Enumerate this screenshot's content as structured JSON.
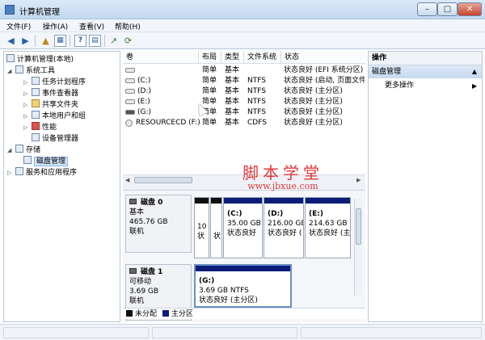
{
  "window": {
    "title": "计算机管理"
  },
  "menu": [
    "文件(F)",
    "操作(A)",
    "查看(V)",
    "帮助(H)"
  ],
  "toolbar": {
    "icons": [
      "back-arrow-icon",
      "forward-arrow-icon",
      "folder-up-icon",
      "console-tree-icon",
      "help-icon",
      "properties-icon",
      "export-icon",
      "refresh-icon"
    ]
  },
  "tree": {
    "items": [
      {
        "label": "计算机管理(本地)"
      },
      {
        "label": "系统工具"
      },
      {
        "label": "任务计划程序"
      },
      {
        "label": "事件查看器"
      },
      {
        "label": "共享文件夹"
      },
      {
        "label": "本地用户和组"
      },
      {
        "label": "性能"
      },
      {
        "label": "设备管理器"
      },
      {
        "label": "存储"
      },
      {
        "label": "磁盘管理"
      },
      {
        "label": "服务和应用程序"
      }
    ]
  },
  "volumes": {
    "columns": [
      "卷",
      "布局",
      "类型",
      "文件系统",
      "状态"
    ],
    "rows": [
      {
        "name": "",
        "layout": "简单",
        "type": "基本",
        "fs": "",
        "status": "状态良好 (EFI 系统分区)"
      },
      {
        "name": "(C:)",
        "layout": "简单",
        "type": "基本",
        "fs": "NTFS",
        "status": "状态良好 (启动, 页面文件"
      },
      {
        "name": "(D:)",
        "layout": "简单",
        "type": "基本",
        "fs": "NTFS",
        "status": "状态良好 (主分区)"
      },
      {
        "name": "(E:)",
        "layout": "简单",
        "type": "基本",
        "fs": "NTFS",
        "status": "状态良好 (主分区)"
      },
      {
        "name": "(G:)",
        "layout": "简单",
        "type": "基本",
        "fs": "NTFS",
        "status": "状态良好 (主分区)"
      },
      {
        "name": "RESOURCECD (F:)",
        "layout": "简单",
        "type": "基本",
        "fs": "CDFS",
        "status": "状态良好 (主分区)"
      }
    ]
  },
  "disks": [
    {
      "name": "磁盘 0",
      "kind": "基本",
      "size": "465.76 GB",
      "status": "联机",
      "partitions": [
        {
          "line1": "10",
          "line2": "状",
          "line3": ""
        },
        {
          "line1": "",
          "line2": "状",
          "line3": ""
        },
        {
          "line1": "(C:)",
          "line2": "35.00 GB",
          "line3": "状态良好"
        },
        {
          "line1": "(D:)",
          "line2": "216.00 GB",
          "line3": "状态良好 ("
        },
        {
          "line1": "(E:)",
          "line2": "214.63 GB",
          "line3": "状态良好 (主"
        }
      ]
    },
    {
      "name": "磁盘 1",
      "kind": "可移动",
      "size": "3.69 GB",
      "status": "联机",
      "partitions": [
        {
          "line1": "(G:)",
          "line2": "3.69 GB NTFS",
          "line3": "状态良好 (主分区)"
        }
      ]
    }
  ],
  "legend": [
    {
      "label": "未分配",
      "color": "#111111"
    },
    {
      "label": "主分区",
      "color": "#0c1c78"
    }
  ],
  "actions": {
    "header": "操作",
    "section": "磁盘管理",
    "more": "更多操作"
  },
  "watermark": {
    "line1": "脚本学堂",
    "line2": "www.jbxue.com"
  },
  "colors": {
    "primary_partition": "#0c1c78",
    "unallocated": "#111111",
    "selection": "#cfe3fb"
  }
}
